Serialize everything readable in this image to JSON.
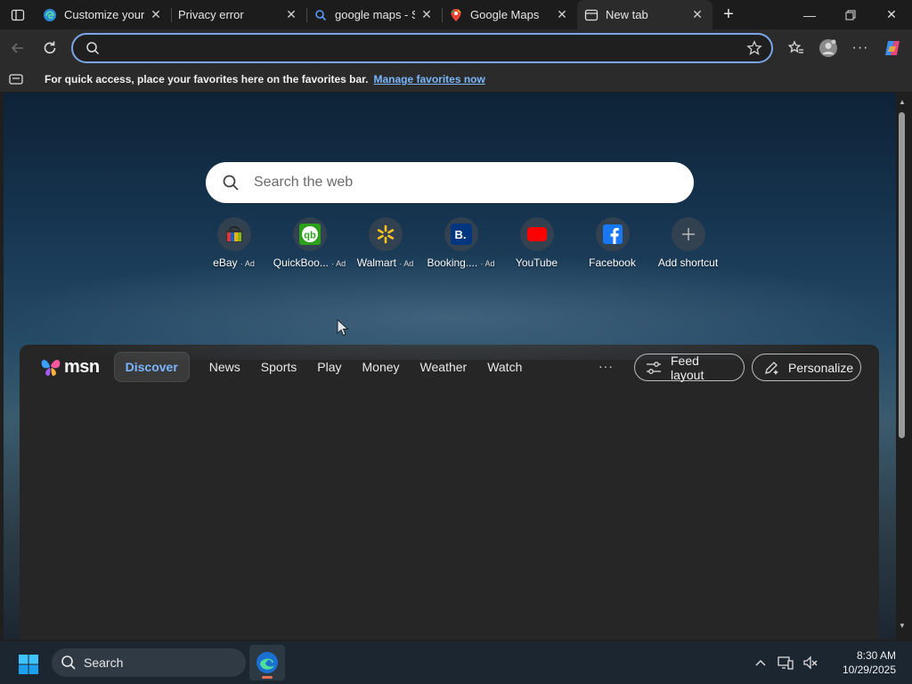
{
  "tabs": [
    {
      "title": "Customize your E",
      "favicon": "edge-icon",
      "active": false
    },
    {
      "title": "Privacy error",
      "favicon": "none",
      "active": false
    },
    {
      "title": "google maps - Se",
      "favicon": "search-icon",
      "active": false
    },
    {
      "title": "Google Maps",
      "favicon": "google-maps-icon",
      "active": false
    },
    {
      "title": "New tab",
      "favicon": "new-tab-icon",
      "active": true
    }
  ],
  "address_bar": {
    "value": "",
    "placeholder": ""
  },
  "favorites_bar": {
    "message": "For quick access, place your favorites here on the favorites bar.",
    "link": "Manage favorites now"
  },
  "new_tab": {
    "search_placeholder": "Search the web",
    "shortcuts": [
      {
        "label": "eBay",
        "ad": "· Ad",
        "icon": "ebay-icon"
      },
      {
        "label": "QuickBoo...",
        "ad": "· Ad",
        "icon": "quickbooks-icon"
      },
      {
        "label": "Walmart",
        "ad": "· Ad",
        "icon": "walmart-icon"
      },
      {
        "label": "Booking....",
        "ad": "· Ad",
        "icon": "booking-icon"
      },
      {
        "label": "YouTube",
        "ad": "",
        "icon": "youtube-icon"
      },
      {
        "label": "Facebook",
        "ad": "",
        "icon": "facebook-icon"
      },
      {
        "label": "Add shortcut",
        "ad": "",
        "icon": "plus-icon"
      }
    ]
  },
  "feed": {
    "logo_text": "msn",
    "nav": [
      "Discover",
      "News",
      "Sports",
      "Play",
      "Money",
      "Weather",
      "Watch"
    ],
    "active_nav": "Discover",
    "more": "···",
    "feed_layout_label": "Feed layout",
    "personalize_label": "Personalize"
  },
  "taskbar": {
    "search_label": "Search",
    "time": "8:30 AM",
    "date": "10/29/2025"
  },
  "colors": {
    "accent": "#7ab7ff",
    "omnibox_border": "#7aa5e8",
    "taskbar": "#1c2630"
  }
}
